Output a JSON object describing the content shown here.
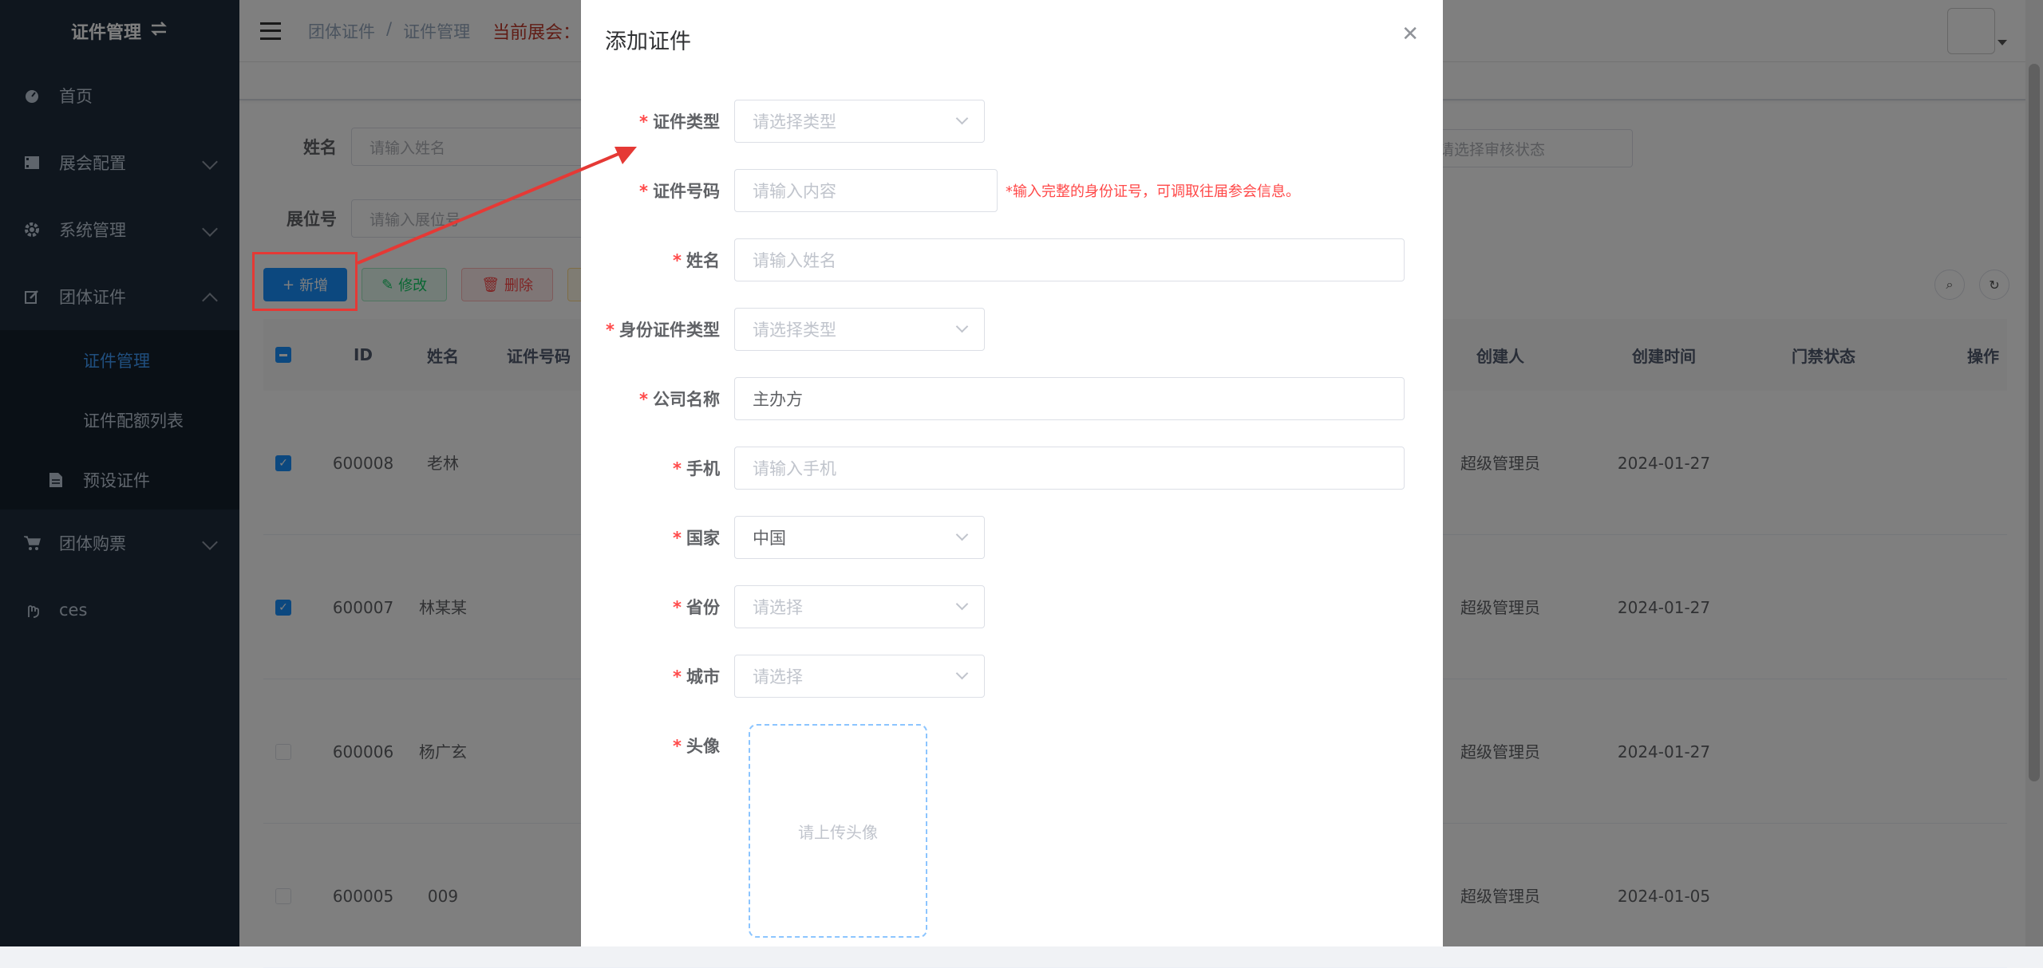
{
  "sidebar": {
    "brand": "证件管理",
    "items": [
      {
        "label": "首页",
        "icon": "dashboard-icon"
      },
      {
        "label": "展会配置",
        "icon": "film-icon"
      },
      {
        "label": "系统管理",
        "icon": "gear-icon"
      },
      {
        "label": "团体证件",
        "icon": "edit-icon"
      },
      {
        "label": "团体购票",
        "icon": "cart-icon"
      },
      {
        "label": "ces",
        "icon": "hand-icon"
      }
    ],
    "submenu": [
      {
        "label": "证件管理"
      },
      {
        "label": "证件配额列表"
      },
      {
        "label": "预设证件"
      }
    ]
  },
  "navbar": {
    "breadcrumb": [
      "团体证件",
      "/",
      "证件管理"
    ],
    "expo_label": "当前展会："
  },
  "search": {
    "name_label": "姓名",
    "name_placeholder": "请输入姓名",
    "booth_label": "展位号",
    "booth_placeholder": "请输入展位号",
    "audit_placeholder": "请选择审核状态"
  },
  "toolbar": {
    "add": "新增",
    "edit": "修改",
    "delete": "删除"
  },
  "table": {
    "headers": {
      "id": "ID",
      "name": "姓名",
      "cert_no": "证件号码",
      "creator": "创建人",
      "created": "创建时间",
      "access": "门禁状态",
      "ops": "操作"
    },
    "rows": [
      {
        "id1": "6000",
        "id2": "08",
        "name": "老林",
        "creator1": "超级管理",
        "creator2": "员",
        "created": "2024-01-27",
        "checked": true
      },
      {
        "id1": "6000",
        "id2": "07",
        "name": "林某某",
        "creator1": "超级管理",
        "creator2": "员",
        "created": "2024-01-27",
        "checked": true
      },
      {
        "id1": "6000",
        "id2": "06",
        "name": "杨广玄",
        "creator1": "超级管理",
        "creator2": "员",
        "created": "2024-01-27",
        "checked": false
      },
      {
        "id1": "6000",
        "id2": "05",
        "name": "009",
        "creator1": "超级管理",
        "creator2": "员",
        "created": "2024-01-05",
        "checked": false
      }
    ]
  },
  "dialog": {
    "title": "添加证件",
    "fields": {
      "cert_type_label": "证件类型",
      "cert_type_placeholder": "请选择类型",
      "cert_no_label": "证件号码",
      "cert_no_placeholder": "请输入内容",
      "cert_no_hint": "*输入完整的身份证号，可调取往届参会信息。",
      "name_label": "姓名",
      "name_placeholder": "请输入姓名",
      "id_type_label": "身份证件类型",
      "id_type_placeholder": "请选择类型",
      "company_label": "公司名称",
      "company_value": "主办方",
      "phone_label": "手机",
      "phone_placeholder": "请输入手机",
      "country_label": "国家",
      "country_value": "中国",
      "province_label": "省份",
      "province_placeholder": "请选择",
      "city_label": "城市",
      "city_placeholder": "请选择",
      "avatar_label": "头像",
      "avatar_placeholder": "请上传头像"
    }
  },
  "colors": {
    "sidebar_bg": "#1f2d3d",
    "primary": "#1890ff",
    "required_star": "#ff4949",
    "annotation": "#e53935"
  }
}
